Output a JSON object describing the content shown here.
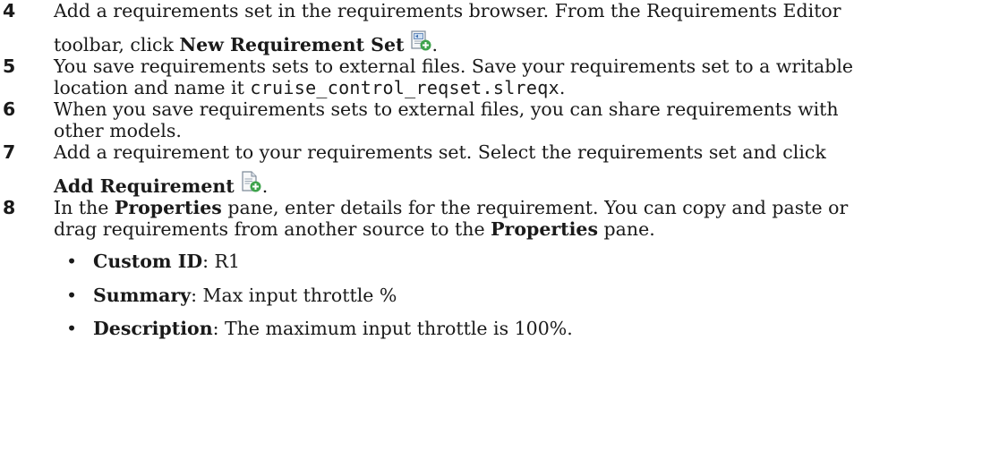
{
  "steps": [
    {
      "number": "4",
      "line1": "Add a requirements set in the requirements browser. From the Requirements Editor",
      "line2_prefix": "toolbar, click ",
      "line2_bold": "New Requirement Set",
      "line2_suffix": ".",
      "icon": "new-requirement-set-icon"
    },
    {
      "number": "5",
      "line1": "You save requirements sets to external files. Save your requirements set to a writable",
      "line2_prefix": "location and name it ",
      "line2_code": "cruise_control_reqset.slreqx",
      "line2_suffix": "."
    },
    {
      "number": "6",
      "line1": "When you save requirements sets to external files, you can share requirements with",
      "line2": "other models."
    },
    {
      "number": "7",
      "line1": "Add a requirement to your requirements set. Select the requirements set and click",
      "line2_bold": "Add Requirement",
      "line2_suffix": ".",
      "icon": "add-requirement-icon"
    },
    {
      "number": "8",
      "line1_prefix": "In the ",
      "line1_bold": "Properties",
      "line1_suffix": " pane, enter details for the requirement. You can copy and paste or",
      "line2_prefix": "drag requirements from another source to the ",
      "line2_bold": "Properties",
      "line2_suffix": " pane."
    }
  ],
  "bullets": [
    {
      "glyph": "•",
      "label": "Custom ID",
      "value": ": R1"
    },
    {
      "glyph": "•",
      "label": "Summary",
      "value": ": Max input throttle %"
    },
    {
      "glyph": "•",
      "label": "Description",
      "value": ": The maximum input throttle is 100%."
    }
  ]
}
